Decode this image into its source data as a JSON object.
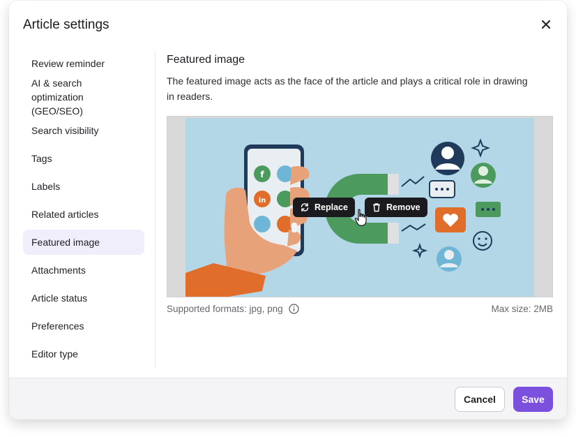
{
  "dialog": {
    "title": "Article settings",
    "close_icon": "close-icon"
  },
  "sidebar": {
    "items": [
      {
        "label": "Review reminder"
      },
      {
        "label": "AI & search optimization (GEO/SEO)"
      },
      {
        "label": "Search visibility"
      },
      {
        "label": "Tags"
      },
      {
        "label": "Labels"
      },
      {
        "label": "Related articles"
      },
      {
        "label": "Featured image",
        "active": true
      },
      {
        "label": "Attachments"
      },
      {
        "label": "Article status"
      },
      {
        "label": "Preferences"
      },
      {
        "label": "Editor type"
      }
    ]
  },
  "featured_image": {
    "title": "Featured image",
    "description": "The featured image acts as the face of the article and plays a critical role in drawing in readers.",
    "replace_label": "Replace",
    "remove_label": "Remove",
    "supported_formats": "Supported formats: jpg, png",
    "max_size": "Max size: 2MB"
  },
  "footer": {
    "cancel_label": "Cancel",
    "save_label": "Save"
  },
  "colors": {
    "accent": "#7b50dc",
    "active_nav_bg": "#f1eefc",
    "image_bg": "#b3d7e6"
  }
}
